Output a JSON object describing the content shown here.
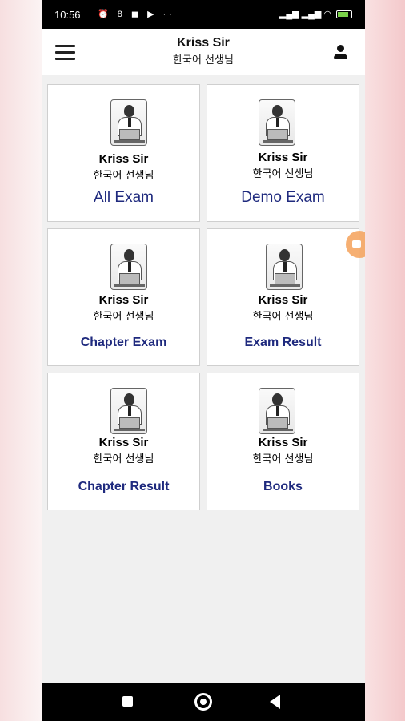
{
  "status_bar": {
    "time": "10:56",
    "left_icons": "⏰ 8 ◼ ▶ ··",
    "right_icons": "▂▄▆ ▂▄▆ ◠",
    "battery_percent": 80
  },
  "header": {
    "title": "Kriss Sir",
    "subtitle": "한국어 선생님"
  },
  "cards": [
    {
      "name": "Kriss Sir",
      "subtitle": "한국어 선생님",
      "label": "All Exam"
    },
    {
      "name": "Kriss Sir",
      "subtitle": "한국어 선생님",
      "label": "Demo Exam"
    },
    {
      "name": "Kriss Sir",
      "subtitle": "한국어 선생님",
      "label": "Chapter Exam"
    },
    {
      "name": "Kriss Sir",
      "subtitle": "한국어 선생님",
      "label": "Exam Result"
    },
    {
      "name": "Kriss Sir",
      "subtitle": "한국어 선생님",
      "label": "Chapter Result"
    },
    {
      "name": "Kriss Sir",
      "subtitle": "한국어 선생님",
      "label": "Books"
    }
  ],
  "colors": {
    "label_color": "#1f2a7e",
    "status_bar": "#000000",
    "background": "#f0f0f0",
    "fab": "#f5a25a"
  },
  "icons": {
    "menu": "hamburger-menu-icon",
    "profile": "person-icon",
    "nav_recent": "square-icon",
    "nav_home": "circle-icon",
    "nav_back": "triangle-back-icon",
    "floating": "video-camera-icon"
  }
}
